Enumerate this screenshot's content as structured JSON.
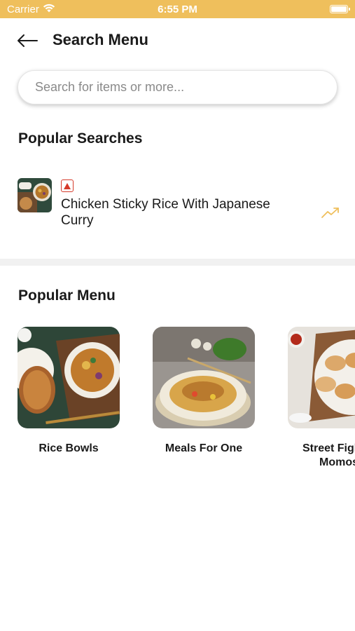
{
  "status_bar": {
    "carrier": "Carrier",
    "time": "6:55 PM"
  },
  "header": {
    "title": "Search Menu"
  },
  "search": {
    "placeholder": "Search for items or more..."
  },
  "popular_searches": {
    "title": "Popular Searches",
    "items": [
      {
        "name": "Chicken Sticky Rice With Japanese Curry",
        "diet_icon": "non-veg-icon",
        "trend_icon": "trending-up-icon"
      }
    ]
  },
  "popular_menu": {
    "title": "Popular Menu",
    "items": [
      {
        "label": "Rice Bowls"
      },
      {
        "label": "Meals For One"
      },
      {
        "label": "Street Fighter\nMomos"
      }
    ]
  },
  "colors": {
    "status_bar": "#efbf5c",
    "non_veg": "#d53a2a",
    "trend": "#efbf5c"
  }
}
